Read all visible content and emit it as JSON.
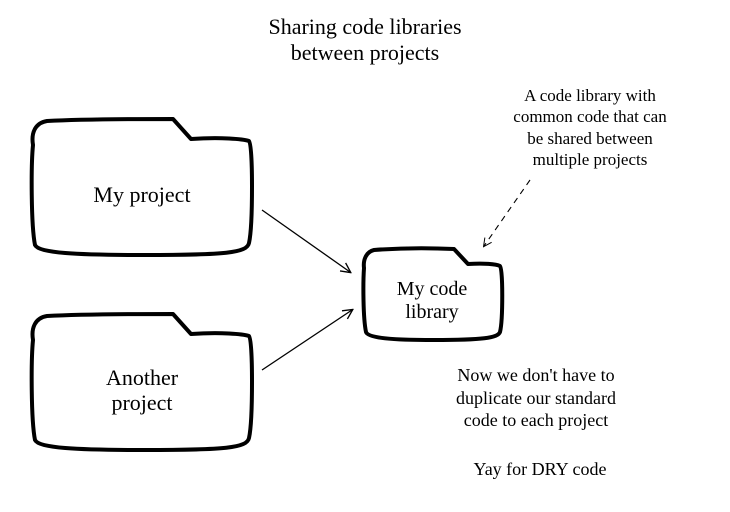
{
  "title": "Sharing code libraries\nbetween projects",
  "nodes": {
    "my_project": {
      "label": "My project"
    },
    "another_project": {
      "label": "Another\nproject"
    },
    "code_library": {
      "label": "My code\nlibrary"
    }
  },
  "notes": {
    "top_right": "A code library with\ncommon code that can\nbe shared between\nmultiple projects",
    "bottom_right": "Now we don't have to\nduplicate our standard\ncode to each project",
    "tagline": "Yay for DRY code"
  },
  "arrows": [
    {
      "from": "my_project",
      "to": "code_library"
    },
    {
      "from": "another_project",
      "to": "code_library"
    },
    {
      "from": "top_right_note",
      "to": "code_library",
      "style": "dashed"
    }
  ]
}
